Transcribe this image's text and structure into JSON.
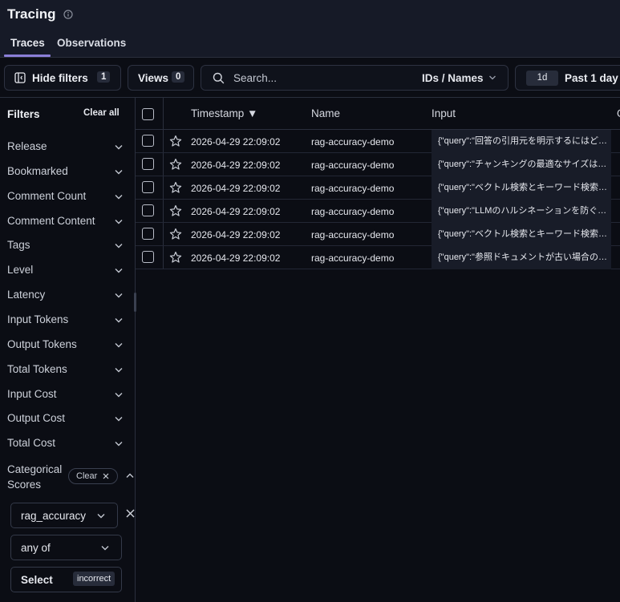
{
  "header": {
    "title": "Tracing"
  },
  "tabs": [
    {
      "label": "Traces",
      "active": true
    },
    {
      "label": "Observations",
      "active": false
    }
  ],
  "toolbar": {
    "hide_filters_label": "Hide filters",
    "hide_filters_count": "1",
    "views_label": "Views",
    "views_count": "0",
    "search_placeholder": "Search...",
    "search_scope": "IDs / Names",
    "range_badge": "1d",
    "range_label": "Past 1 day"
  },
  "filters": {
    "title": "Filters",
    "clear_all": "Clear all",
    "items": [
      "Release",
      "Bookmarked",
      "Comment Count",
      "Comment Content",
      "Tags",
      "Level",
      "Latency",
      "Input Tokens",
      "Output Tokens",
      "Total Tokens",
      "Input Cost",
      "Output Cost",
      "Total Cost"
    ],
    "categorical": {
      "label": "Categorical Scores",
      "clear_label": "Clear",
      "score_name": "rag_accuracy",
      "operator": "any of",
      "select_label": "Select",
      "selected_value": "incorrect"
    }
  },
  "table": {
    "columns": {
      "timestamp": "Timestamp ▼",
      "name": "Name",
      "input": "Input",
      "more": "O"
    },
    "rows": [
      {
        "timestamp": "2026-04-29 22:09:02",
        "name": "rag-accuracy-demo",
        "input": "{\"query\":\"回答の引用元を明示するにはどうすればよいですか\"}"
      },
      {
        "timestamp": "2026-04-29 22:09:02",
        "name": "rag-accuracy-demo",
        "input": "{\"query\":\"チャンキングの最適なサイズは何ですか\"}"
      },
      {
        "timestamp": "2026-04-29 22:09:02",
        "name": "rag-accuracy-demo",
        "input": "{\"query\":\"ベクトル検索とキーワード検索の違いは何ですか\"}"
      },
      {
        "timestamp": "2026-04-29 22:09:02",
        "name": "rag-accuracy-demo",
        "input": "{\"query\":\"LLMのハルシネーションを防ぐ方法は\"}"
      },
      {
        "timestamp": "2026-04-29 22:09:02",
        "name": "rag-accuracy-demo",
        "input": "{\"query\":\"ベクトル検索とキーワード検索を組み合わせるには\"}"
      },
      {
        "timestamp": "2026-04-29 22:09:02",
        "name": "rag-accuracy-demo",
        "input": "{\"query\":\"参照ドキュメントが古い場合の対処法は\"}"
      }
    ]
  },
  "colors": {
    "accent": "#8b7fd8",
    "background": "#0b0d14",
    "header_bg": "#161a27"
  }
}
